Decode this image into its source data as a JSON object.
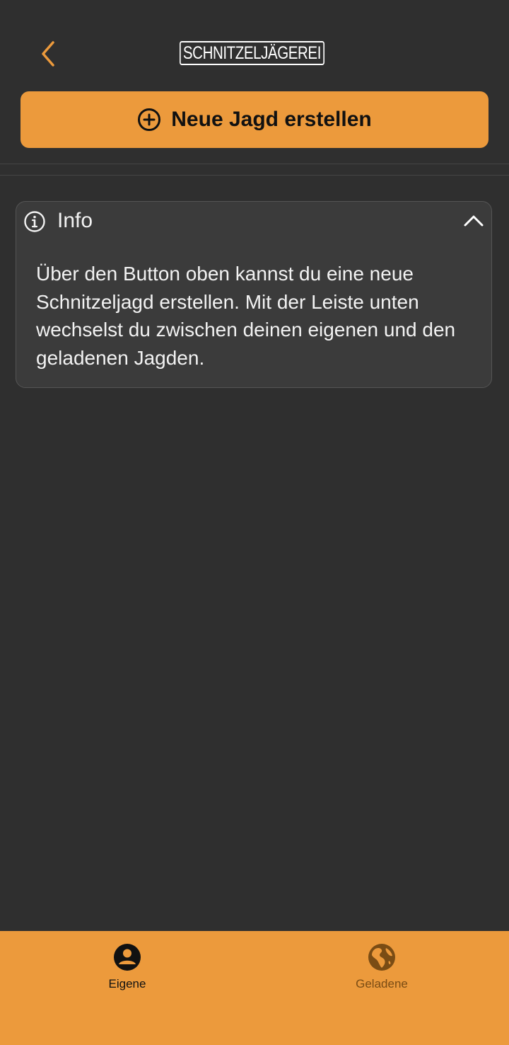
{
  "header": {
    "logo_text": "SCHNITZELJÄGEREI",
    "create_button_label": "Neue Jagd erstellen"
  },
  "info": {
    "title": "Info",
    "text": "Über den Button oben kannst du eine neue Schnitzeljagd erstellen. Mit der Leiste unten wechselst du zwischen deinen eigenen und den geladenen Jagden."
  },
  "tabs": [
    {
      "label": "Eigene",
      "icon": "person-circle-icon",
      "active": true
    },
    {
      "label": "Geladene",
      "icon": "globe-icon",
      "active": false
    }
  ],
  "colors": {
    "accent": "#ec9a3c",
    "background": "#2f2f2f",
    "card": "#3b3b3b"
  }
}
